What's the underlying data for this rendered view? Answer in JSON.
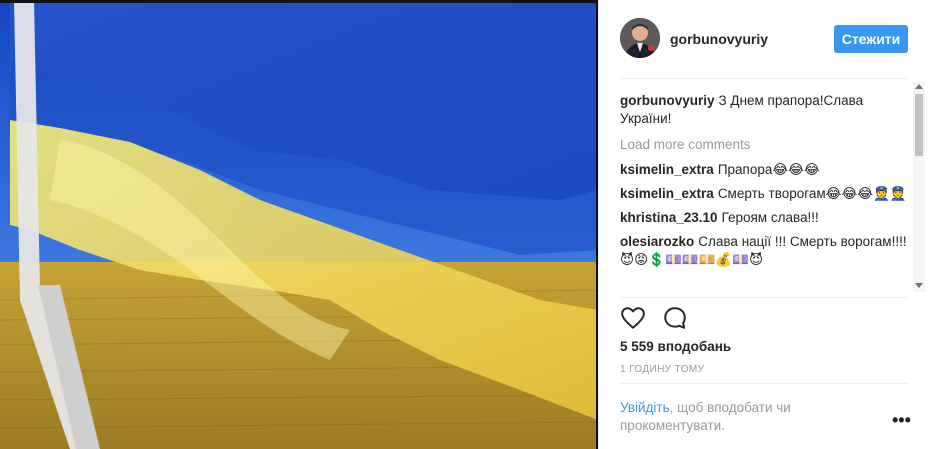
{
  "post": {
    "username": "gorbunovyuriy",
    "follow_label": "Стежити",
    "caption_user": "gorbunovyuriy",
    "caption_text": "З Днем прапора!Слава України!",
    "load_more_label": "Load more comments",
    "comments": [
      {
        "user": "ksimelin_extra",
        "text": "Прапора😂😂😂"
      },
      {
        "user": "ksimelin_extra",
        "text": "Смерть творогам😂😂😂👮👮"
      },
      {
        "user": "khristina_23.10",
        "text": "Героям слава!!!"
      },
      {
        "user": "olesiarozko",
        "text": "Слава нації !!! Смерть ворогам!!!!😈😡💲💷💷💴💰💷😈"
      }
    ],
    "likes": "5 559 вподобань",
    "time": "1 ГОДИНУ ТОМУ",
    "login_link": "Увійдіть",
    "login_rest": ", щоб вподобати чи прокоментувати.",
    "more_label": "•••"
  },
  "icons": {
    "like": "heart-icon",
    "comment": "comment-bubble-icon",
    "more": "more-options-icon"
  },
  "colors": {
    "accent": "#3897f0",
    "text": "#262626",
    "muted": "#999999",
    "flag_blue": "#1d57c9",
    "flag_yellow": "#f0d94a"
  }
}
